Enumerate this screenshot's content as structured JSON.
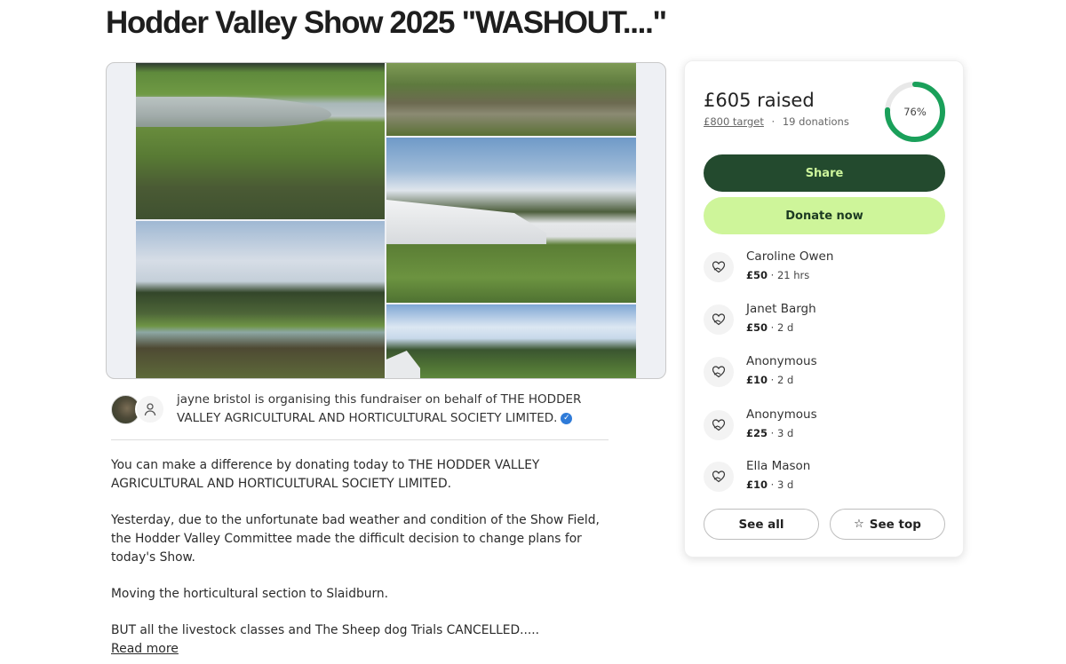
{
  "page": {
    "title": "Hodder Valley Show 2025 \"WASHOUT....\""
  },
  "organiser": {
    "text": "jayne bristol is organising this fundraiser on behalf of THE HODDER VALLEY AGRICULTURAL AND HORTICULTURAL SOCIETY LIMITED."
  },
  "story": {
    "paragraphs": [
      "You can make a difference by donating today to THE HODDER VALLEY AGRICULTURAL AND HORTICULTURAL SOCIETY LIMITED.",
      "Yesterday, due to the unfortunate bad weather and condition of the Show Field, the Hodder Valley Committee made the difficult decision to change plans for today's Show.",
      "Moving the horticultural section to Slaidburn.",
      "BUT all the livestock classes and The Sheep dog Trials CANCELLED....."
    ],
    "read_more": "Read more"
  },
  "donation": {
    "raised": "£605 raised",
    "target": "£800 target",
    "separator": "·",
    "donations": "19 donations",
    "percent_label": "76%",
    "progress": 0.76,
    "share_label": "Share",
    "donate_label": "Donate now",
    "see_all_label": "See all",
    "see_top_label": "See top",
    "colors": {
      "progress": "#1aa05a",
      "track": "#e8e8e8",
      "share_bg": "#234a2e",
      "donate_bg": "#cef59a"
    },
    "donors": [
      {
        "name": "Caroline Owen",
        "amount": "£50",
        "time": "21 hrs"
      },
      {
        "name": "Janet Bargh",
        "amount": "£50",
        "time": "2 d"
      },
      {
        "name": "Anonymous",
        "amount": "£10",
        "time": "2 d"
      },
      {
        "name": "Anonymous",
        "amount": "£25",
        "time": "3 d"
      },
      {
        "name": "Ella Mason",
        "amount": "£10",
        "time": "3 d"
      }
    ]
  },
  "icons": {
    "organiser_avatar": "user-icon",
    "verified": "verified-check-icon",
    "donor": "heart-hand-icon",
    "see_top": "star-icon"
  }
}
